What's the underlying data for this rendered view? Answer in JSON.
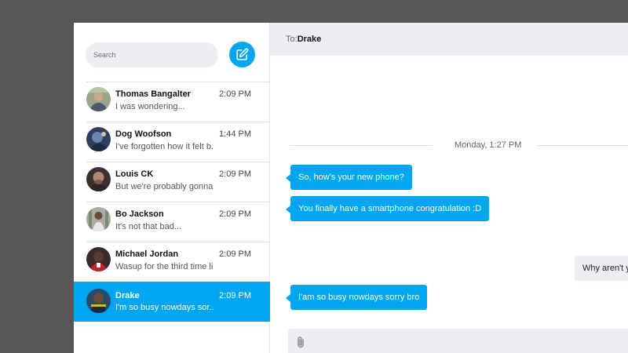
{
  "sidebar": {
    "search": {
      "placeholder": "Search",
      "value": ""
    },
    "compose_icon": "compose-icon",
    "conversations": [
      {
        "name": "Thomas Bangalter",
        "time": "2:09 PM",
        "preview": "I was wondering...",
        "avatar_color": "#7a8c6a",
        "active": false
      },
      {
        "name": "Dog Woofson",
        "time": "1:44 PM",
        "preview": "I've forgotten how it felt b...",
        "avatar_color": "#3b4a6b",
        "active": false
      },
      {
        "name": "Louis CK",
        "time": "2:09 PM",
        "preview": "But we're probably gonna...",
        "avatar_color": "#5a4a42",
        "active": false
      },
      {
        "name": "Bo Jackson",
        "time": "2:09 PM",
        "preview": "It's not that bad...",
        "avatar_color": "#8a9080",
        "active": false
      },
      {
        "name": "Michael Jordan",
        "time": "2:09 PM",
        "preview": "Wasup for the third time li...",
        "avatar_color": "#4a2f2f",
        "active": false
      },
      {
        "name": "Drake",
        "time": "2:09 PM",
        "preview": "I'm so busy nowdays sor...",
        "avatar_color": "#2f4a6b",
        "active": true
      }
    ]
  },
  "chat": {
    "to_label": "To:",
    "to_name": "Drake",
    "date_divider": "Monday, 1:27 PM",
    "messages": [
      {
        "direction": "in",
        "text": "So, how's your new phone?"
      },
      {
        "direction": "in",
        "text": "You finally have a smartphone congratulation :D"
      },
      {
        "direction": "out",
        "text": "Why aren't you"
      },
      {
        "direction": "in",
        "text": "I'am so busy nowdays sorry bro"
      }
    ],
    "attach_icon": "paperclip-icon"
  },
  "colors": {
    "accent": "#00a6ef",
    "panel": "#eceef1",
    "backdrop": "#575757"
  }
}
